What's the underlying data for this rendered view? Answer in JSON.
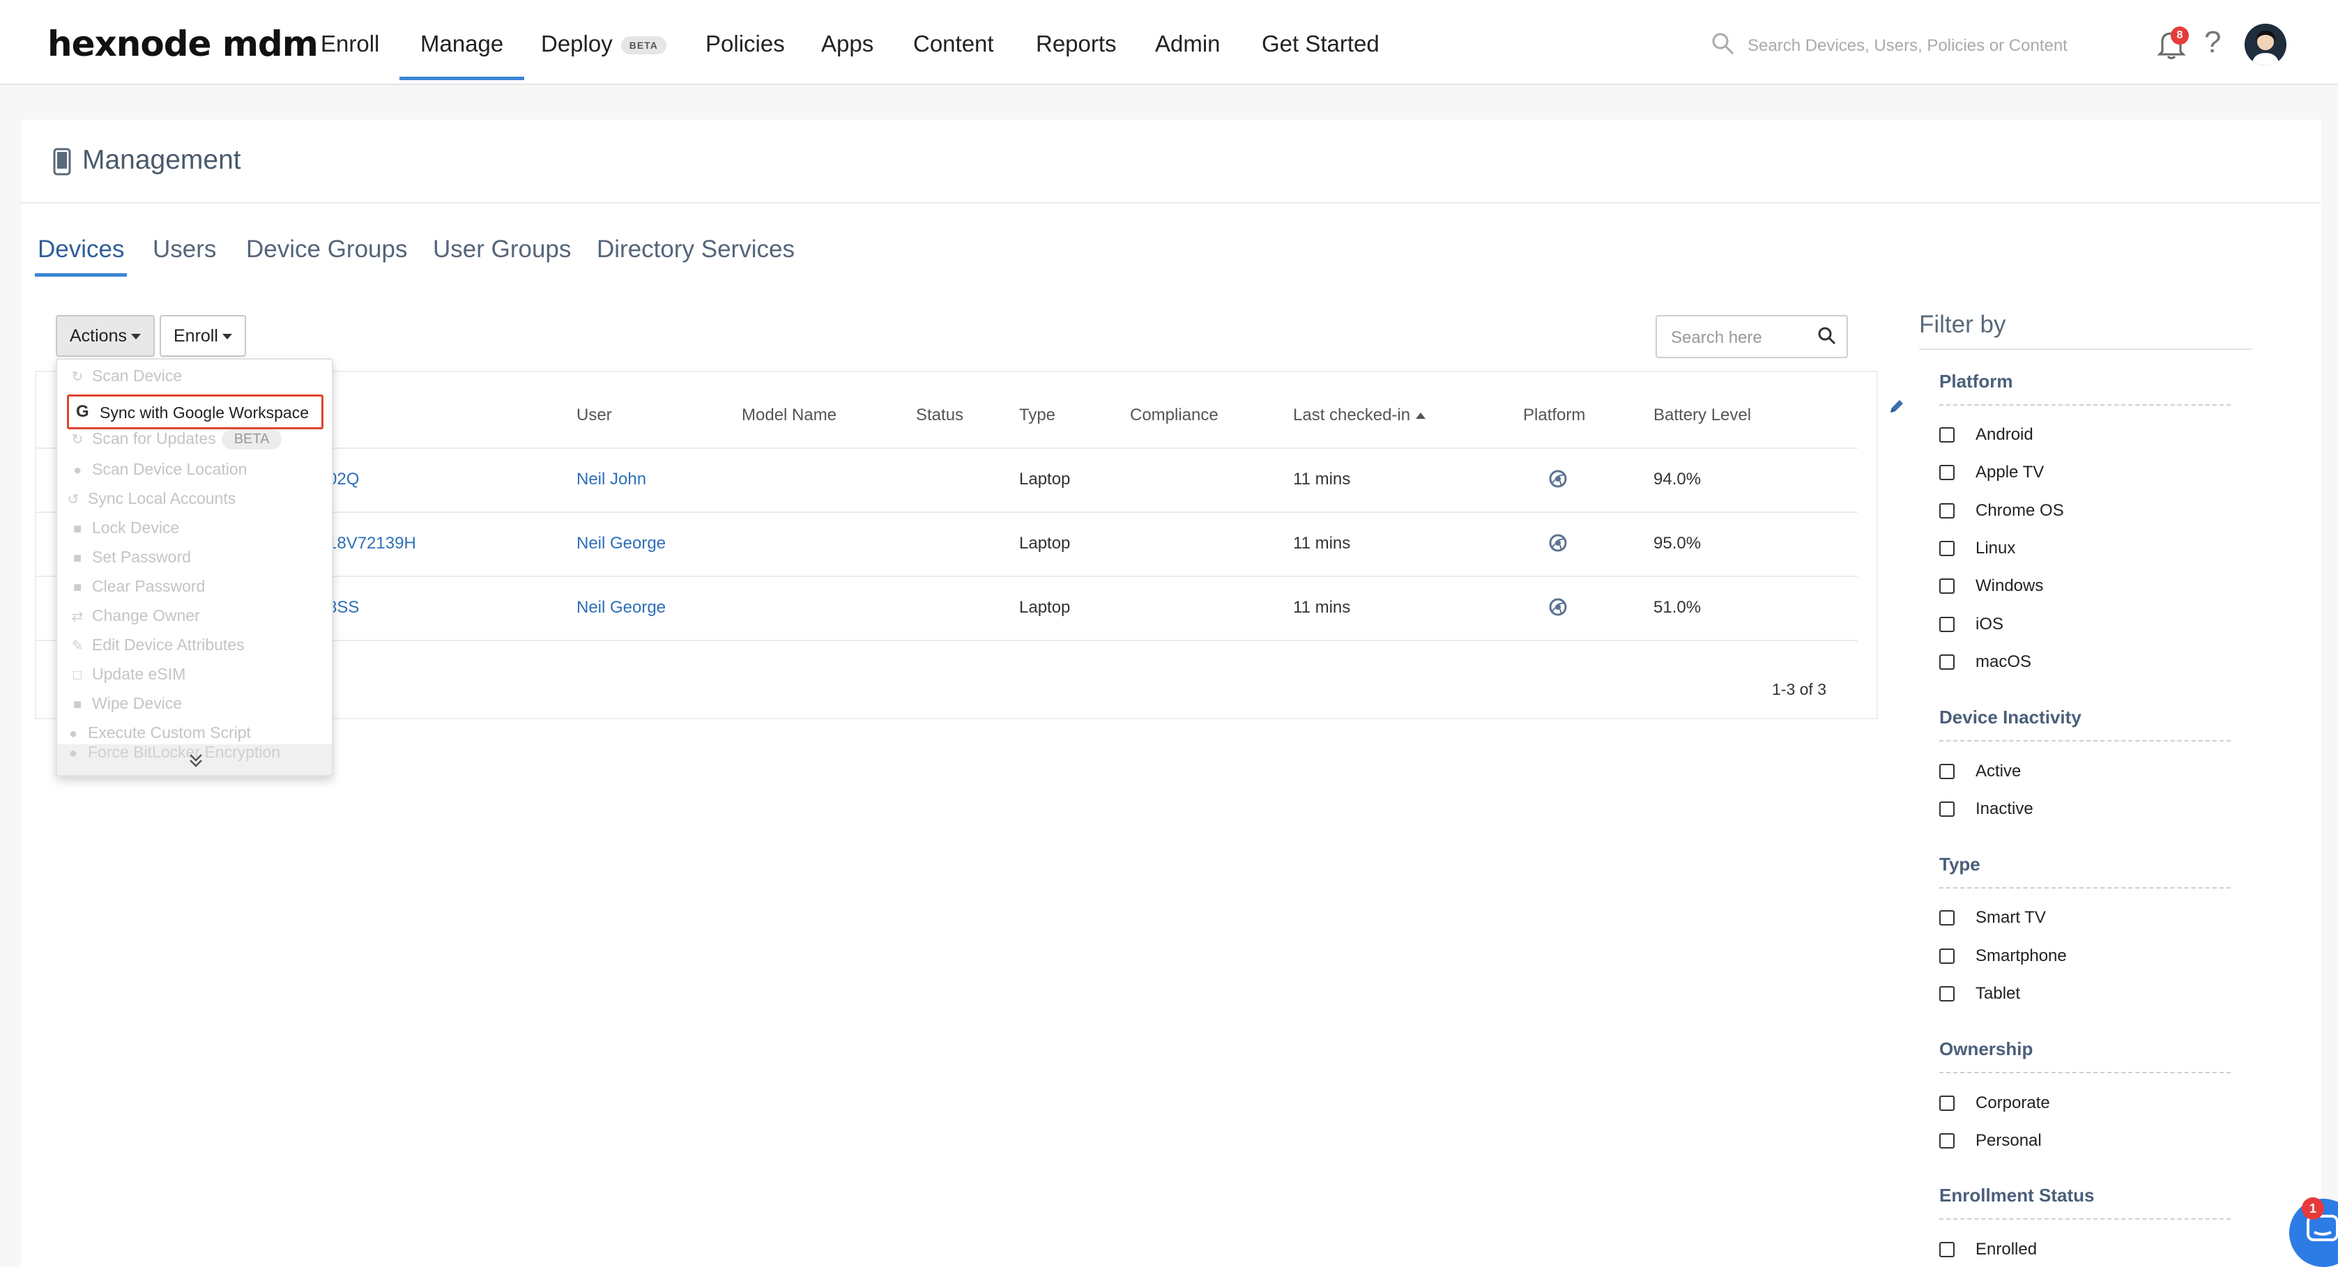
{
  "brand": {
    "logo_text": "hexnode mdm",
    "accent": "#3b86d6",
    "link_color": "#2e6fb8",
    "alert_color": "#e63b3b",
    "highlight_border": "#e0452c"
  },
  "topnav": {
    "items": [
      {
        "label": "Enroll"
      },
      {
        "label": "Manage"
      },
      {
        "label": "Deploy",
        "badge": "BETA"
      },
      {
        "label": "Policies"
      },
      {
        "label": "Apps"
      },
      {
        "label": "Content"
      },
      {
        "label": "Reports"
      },
      {
        "label": "Admin"
      },
      {
        "label": "Get Started"
      }
    ],
    "active": "Manage",
    "search_placeholder": "Search Devices, Users, Policies or Content",
    "notification_count": "8",
    "help_label": "?",
    "icons": [
      "search-icon",
      "bell-icon",
      "help-icon",
      "avatar"
    ]
  },
  "management": {
    "title": "Management",
    "icon": "mobile-device-icon",
    "tabs": [
      {
        "label": "Devices"
      },
      {
        "label": "Users"
      },
      {
        "label": "Device Groups"
      },
      {
        "label": "User Groups"
      },
      {
        "label": "Directory Services"
      }
    ],
    "active_tab": "Devices"
  },
  "toolbar": {
    "actions_label": "Actions",
    "enroll_label": "Enroll",
    "search_placeholder": "Search here"
  },
  "actions_menu": {
    "items": [
      {
        "label": "Scan Device",
        "icon": "refresh-icon",
        "enabled": false
      },
      {
        "label": "Sync with Google Workspace",
        "icon": "google-icon",
        "enabled": true,
        "highlighted": true
      },
      {
        "label": "Scan for Updates",
        "icon": "refresh-icon",
        "enabled": false,
        "badge": "BETA"
      },
      {
        "label": "Scan Device Location",
        "icon": "location-pin-icon",
        "enabled": false
      },
      {
        "label": "Sync Local Accounts",
        "icon": "sync-icon",
        "enabled": false
      },
      {
        "label": "Lock Device",
        "icon": "lock-icon",
        "enabled": false
      },
      {
        "label": "Set Password",
        "icon": "lock-icon",
        "enabled": false
      },
      {
        "label": "Clear Password",
        "icon": "lock-icon",
        "enabled": false
      },
      {
        "label": "Change Owner",
        "icon": "swap-icon",
        "enabled": false
      },
      {
        "label": "Edit Device Attributes",
        "icon": "pencil-icon",
        "enabled": false
      },
      {
        "label": "Update eSIM",
        "icon": "sim-icon",
        "enabled": false
      },
      {
        "label": "Wipe Device",
        "icon": "trash-icon",
        "enabled": false
      },
      {
        "label": "Execute Custom Script",
        "icon": "script-icon",
        "enabled": false
      },
      {
        "label": "Force BitLocker Encryption",
        "icon": "shield-icon",
        "enabled": false
      }
    ],
    "more_icon": "double-chevron-down-icon"
  },
  "table": {
    "columns": [
      "User",
      "Model Name",
      "Status",
      "Type",
      "Compliance",
      "Last checked-in",
      "Platform",
      "Battery Level"
    ],
    "sorted_column": "Last checked-in",
    "rows": [
      {
        "device_fragment": "02Q",
        "user": "Neil John",
        "model": "",
        "status": "",
        "type": "Laptop",
        "compliance": "",
        "last_checked_in": "11 mins",
        "platform_icon": "chrome-os-icon",
        "battery": "94.0%"
      },
      {
        "device_fragment": "18V72139H",
        "user": "Neil George",
        "model": "",
        "status": "",
        "type": "Laptop",
        "compliance": "",
        "last_checked_in": "11 mins",
        "platform_icon": "chrome-os-icon",
        "battery": "95.0%"
      },
      {
        "device_fragment": "8SS",
        "user": "Neil George",
        "model": "",
        "status": "",
        "type": "Laptop",
        "compliance": "",
        "last_checked_in": "11 mins",
        "platform_icon": "chrome-os-icon",
        "battery": "51.0%"
      }
    ],
    "pagination": "1-3 of 3"
  },
  "filters": {
    "title": "Filter by",
    "groups": [
      {
        "name": "Platform",
        "options": [
          "Android",
          "Apple TV",
          "Chrome OS",
          "Linux",
          "Windows",
          "iOS",
          "macOS"
        ]
      },
      {
        "name": "Device Inactivity",
        "options": [
          "Active",
          "Inactive"
        ]
      },
      {
        "name": "Type",
        "options": [
          "Smart TV",
          "Smartphone",
          "Tablet"
        ]
      },
      {
        "name": "Ownership",
        "options": [
          "Corporate",
          "Personal"
        ]
      },
      {
        "name": "Enrollment Status",
        "options": [
          "Enrolled"
        ]
      }
    ]
  },
  "chat": {
    "unread": "1"
  }
}
